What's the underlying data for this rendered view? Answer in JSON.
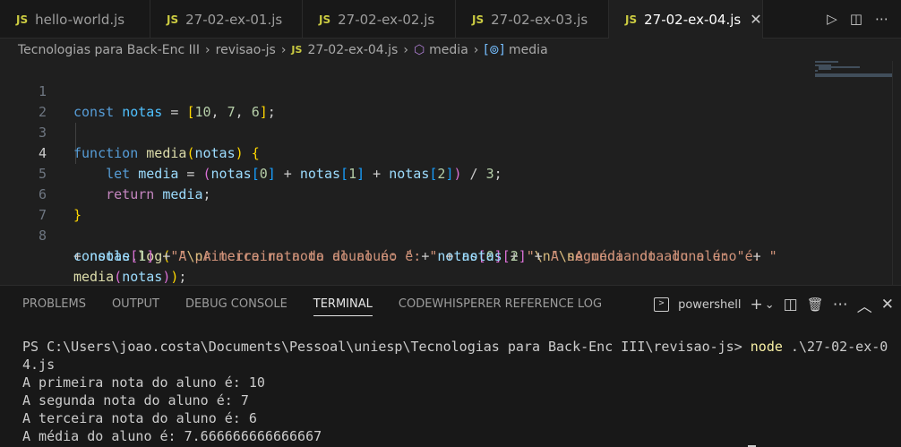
{
  "tabs": [
    {
      "icon": "JS",
      "label": "hello-world.js"
    },
    {
      "icon": "JS",
      "label": "27-02-ex-01.js"
    },
    {
      "icon": "JS",
      "label": "27-02-ex-02.js"
    },
    {
      "icon": "JS",
      "label": "27-02-ex-03.js"
    },
    {
      "icon": "JS",
      "label": "27-02-ex-04.js",
      "close": "✕"
    }
  ],
  "breadcrumb": {
    "folder1": "Tecnologias para Back-Enc III",
    "folder2": "revisao-js",
    "file_icon": "JS",
    "file": "27-02-ex-04.js",
    "symbol1": "media",
    "symbol2": "media"
  },
  "editor": {
    "line_numbers": [
      "1",
      "2",
      "3",
      "4",
      "5",
      "6",
      "7",
      "8"
    ],
    "current_line": "4"
  },
  "panel": {
    "tabs": [
      "PROBLEMS",
      "OUTPUT",
      "DEBUG CONSOLE",
      "TERMINAL",
      "CODEWHISPERER REFERENCE LOG"
    ],
    "active_tab": "TERMINAL",
    "shell": "powershell",
    "icons": {
      "term": ">",
      "add": "+",
      "chevron": "⌄",
      "split": "◫",
      "trash": "🗑",
      "more": "⋯",
      "maximize": "︿",
      "close": "✕"
    }
  },
  "terminal": {
    "prompt": "PS C:\\Users\\joao.costa\\Documents\\Pessoal\\uniesp\\Tecnologias para Back-Enc III\\revisao-js> ",
    "command": "node",
    "command_arg": " .\\27-02-ex-0",
    "command_wrap": "4.js",
    "output": [
      "A primeira nota do aluno é: 10",
      "A segunda nota do aluno é: 7",
      "A terceira nota do aluno é: 6",
      "A média do aluno é: 7.666666666666667"
    ]
  },
  "colors": {
    "accent_js": "#cbcb41",
    "keyword": "#569cd6",
    "string": "#ce9178",
    "variable": "#9cdcfe"
  }
}
